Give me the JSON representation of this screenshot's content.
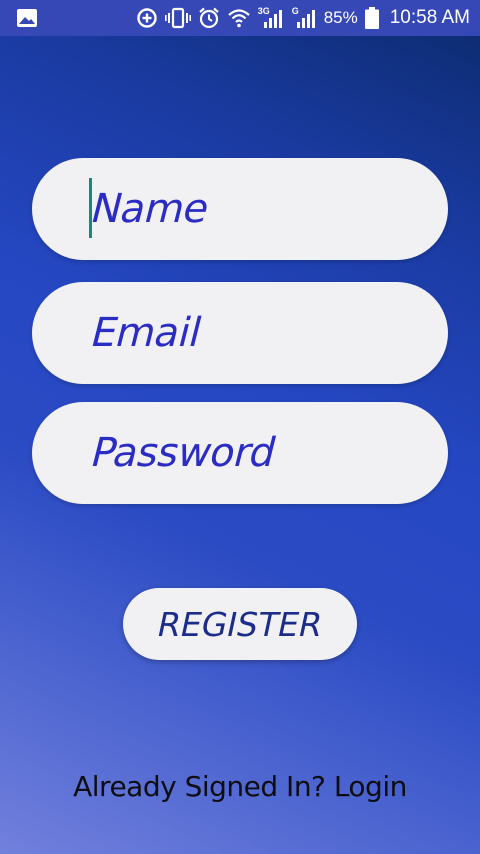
{
  "status_bar": {
    "left_icon": "image-icon",
    "icons": [
      "data-saver-icon",
      "vibrate-icon",
      "alarm-icon",
      "wifi-icon",
      "signal-3g-icon",
      "signal-g-icon"
    ],
    "net_3g": "3G",
    "net_g": "G",
    "battery_percent": "85%",
    "time": "10:58 AM"
  },
  "form": {
    "name_placeholder": "Name",
    "email_placeholder": "Email",
    "password_placeholder": "Password",
    "register_label": "REGISTER",
    "login_prompt": "Already Signed In? Login"
  },
  "colors": {
    "status_bar": "#3648b6",
    "placeholder_text": "#2a2cc4",
    "button_text": "#1b2d88",
    "field_background": "#f1f1f3",
    "caret": "#138a7b"
  }
}
